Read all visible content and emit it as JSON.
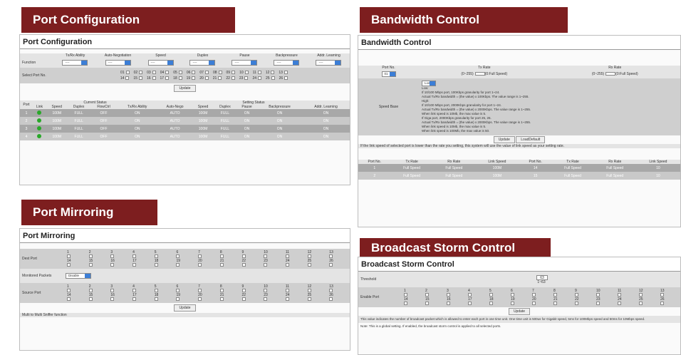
{
  "banners": {
    "port_config": "Port Configuration",
    "bandwidth": "Bandwidth Control",
    "mirroring": "Port Mirroring",
    "broadcast": "Broadcast Storm Control"
  },
  "port_config": {
    "title": "Port Configuration",
    "columns": [
      "Tx/Rx Ability",
      "Auto-Negotiation",
      "Speed",
      "Duplex",
      "Pause",
      "Backpressure",
      "Addr. Learning"
    ],
    "function_label": "Function",
    "select_value": "----",
    "select_ports_label": "Select Port No.",
    "ports_row1": [
      "01",
      "02",
      "03",
      "04",
      "05",
      "06",
      "07",
      "08",
      "09",
      "10",
      "11",
      "12",
      "13"
    ],
    "ports_row2": [
      "14",
      "15",
      "16",
      "17",
      "18",
      "19",
      "20",
      "21",
      "22",
      "23",
      "24",
      "25",
      "26"
    ],
    "update_label": "Update",
    "current_status": "Current Status",
    "setting_status": "Setting Status",
    "port_label": "Port",
    "status_headers": [
      "Link",
      "Speed",
      "Duplex",
      "FlowCtrl",
      "Tx/Rx Ability",
      "Auto-Nego",
      "Speed",
      "Duplex",
      "Pause",
      "Backpressure",
      "Addr. Learning"
    ],
    "rows": [
      {
        "port": "1",
        "speed": "100M",
        "duplex": "FULL",
        "flow": "OFF",
        "txrx": "ON",
        "auto": "AUTO",
        "sspeed": "100M",
        "sduplex": "FULL",
        "pause": "ON",
        "bp": "ON",
        "addr": "ON"
      },
      {
        "port": "2",
        "speed": "100M",
        "duplex": "FULL",
        "flow": "OFF",
        "txrx": "ON",
        "auto": "AUTO",
        "sspeed": "100M",
        "sduplex": "FULL",
        "pause": "ON",
        "bp": "ON",
        "addr": "ON"
      },
      {
        "port": "3",
        "speed": "100M",
        "duplex": "FULL",
        "flow": "OFF",
        "txrx": "ON",
        "auto": "AUTO",
        "sspeed": "100M",
        "sduplex": "FULL",
        "pause": "ON",
        "bp": "ON",
        "addr": "ON"
      },
      {
        "port": "4",
        "speed": "100M",
        "duplex": "FULL",
        "flow": "OFF",
        "txrx": "ON",
        "auto": "AUTO",
        "sspeed": "100M",
        "sduplex": "FULL",
        "pause": "ON",
        "bp": "ON",
        "addr": "ON"
      }
    ]
  },
  "bandwidth": {
    "title": "Bandwidth Control",
    "port_no": "Port No.",
    "tx_rate": "Tx Rate",
    "rx_rate": "Rx Rate",
    "port_value": "01",
    "range_text": "(0~255)",
    "full_speed": "(0:Full Speed)",
    "speed_base": "Speed Base",
    "speed_base_value": "Low",
    "desc_lines": [
      "Low:",
      "If 10/100 Mbps port, 100Kbps granularity for port 1~24.",
      "Actual Tx/Rx bandwidth = (the value) x 100Kbps. The value range is 1~255.",
      "High:",
      "If 10/100 Mbps port, 2000Kbps granularity for port 1~24.",
      "Actual Tx/Rx bandwidth = (the value) x 2000Kbps. The value range is 1~255.",
      "When link speed is 10Mb, the max value is 5.",
      "If Giga port, 2000Kbps granularity for port 25, 26.",
      "Actual Tx/Rx bandwidth = (the value) x 2000Kbps. The value range is 1~255.",
      "When link speed is 10Mb, the max value is 5.",
      "When link speed is 100Mb, the max value is 50."
    ],
    "update_label": "Update",
    "load_default": "LoadDefault",
    "note": "If the link speed of selected port is lower than the rate you setting, this system will use the value of link speed as your setting rate.",
    "table_headers": [
      "Port No.",
      "Tx Rate",
      "Rx Rate",
      "Link Speed",
      "Port No.",
      "Tx Rate",
      "Rx Rate",
      "Link Speed"
    ],
    "rows": [
      {
        "p1": "1",
        "tx1": "Full Speed",
        "rx1": "Full Speed",
        "ls1": "100M",
        "p2": "14",
        "tx2": "Full Speed",
        "rx2": "Full Speed",
        "ls2": "10"
      },
      {
        "p1": "2",
        "tx1": "Full Speed",
        "rx1": "Full Speed",
        "ls1": "100M",
        "p2": "15",
        "tx2": "Full Speed",
        "rx2": "Full Speed",
        "ls2": "10"
      }
    ]
  },
  "mirroring": {
    "title": "Port Mirroring",
    "dest_label": "Dest Port",
    "monitored_label": "Monitored Packets",
    "monitored_value": "Disable",
    "source_label": "Source Port",
    "row1": [
      "1",
      "2",
      "3",
      "4",
      "5",
      "6",
      "7",
      "8",
      "9",
      "10",
      "11",
      "12",
      "13"
    ],
    "row2": [
      "14",
      "15",
      "16",
      "17",
      "18",
      "19",
      "20",
      "21",
      "22",
      "23",
      "24",
      "25",
      "26"
    ],
    "update_label": "Update",
    "footer": "Multi to Multi Sniffer function"
  },
  "broadcast": {
    "title": "Broadcast Storm Control",
    "threshold_label": "Threshold",
    "threshold_value": "63",
    "threshold_unit": "1~63",
    "enable_label": "Enable Port",
    "row1": [
      "1",
      "2",
      "3",
      "4",
      "5",
      "6",
      "7",
      "8",
      "9",
      "10",
      "11",
      "12",
      "13"
    ],
    "row2": [
      "14",
      "15",
      "16",
      "17",
      "18",
      "19",
      "20",
      "21",
      "22",
      "23",
      "24",
      "25",
      "26"
    ],
    "update_label": "Update",
    "desc1": "This value indicates the number of broadcast packet which is allowed to enter each port in one time unit. One time unit is 500us for Gigabit speed, 5ms for 100Mbps speed and 50ms for 10Mbps speed.",
    "desc2": "Note: This is a global setting. If enabled, the broadcast storm control is applied to all selected ports."
  }
}
